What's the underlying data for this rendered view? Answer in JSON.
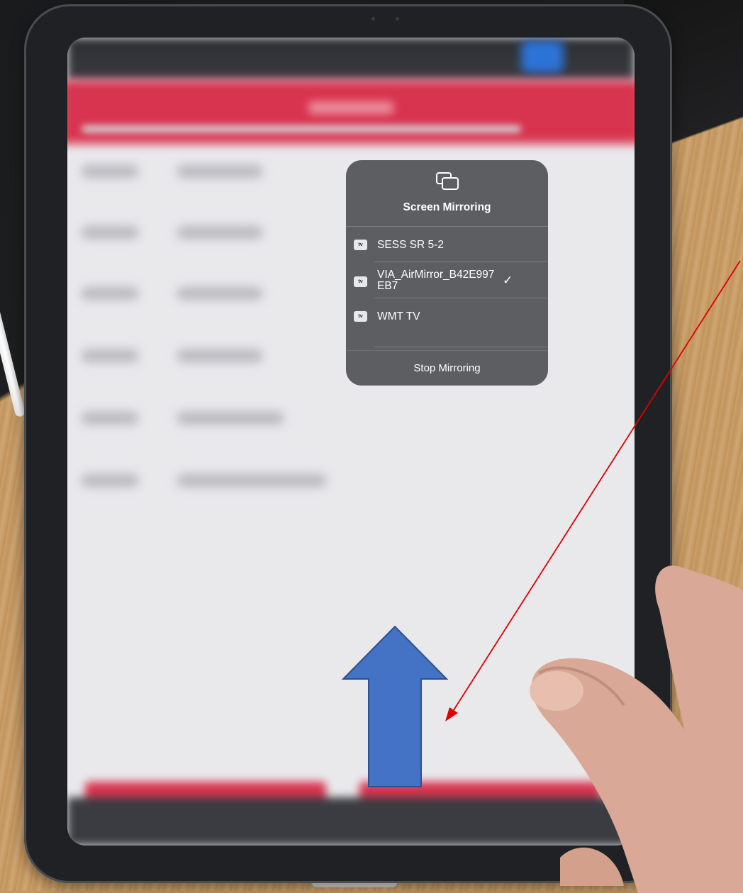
{
  "popover": {
    "title": "Screen Mirroring",
    "badge_label": "tv",
    "devices": [
      {
        "name": "SESS SR 5-2",
        "selected": false
      },
      {
        "name": "VIA_AirMirror_B42E997",
        "name_line2": "EB7",
        "selected": true
      },
      {
        "name": "WMT TV",
        "selected": false
      }
    ],
    "check_mark": "✓",
    "stop_label": "Stop Mirroring"
  },
  "colors": {
    "panel_bg": "#5d5e62",
    "app_accent": "#d8344f",
    "arrow_fill": "#4472c4",
    "annotation_line": "#e00000"
  },
  "icons": {
    "mirror": "screen-mirroring-icon",
    "apple_tv": "apple-tv-icon",
    "check": "checkmark-icon"
  }
}
